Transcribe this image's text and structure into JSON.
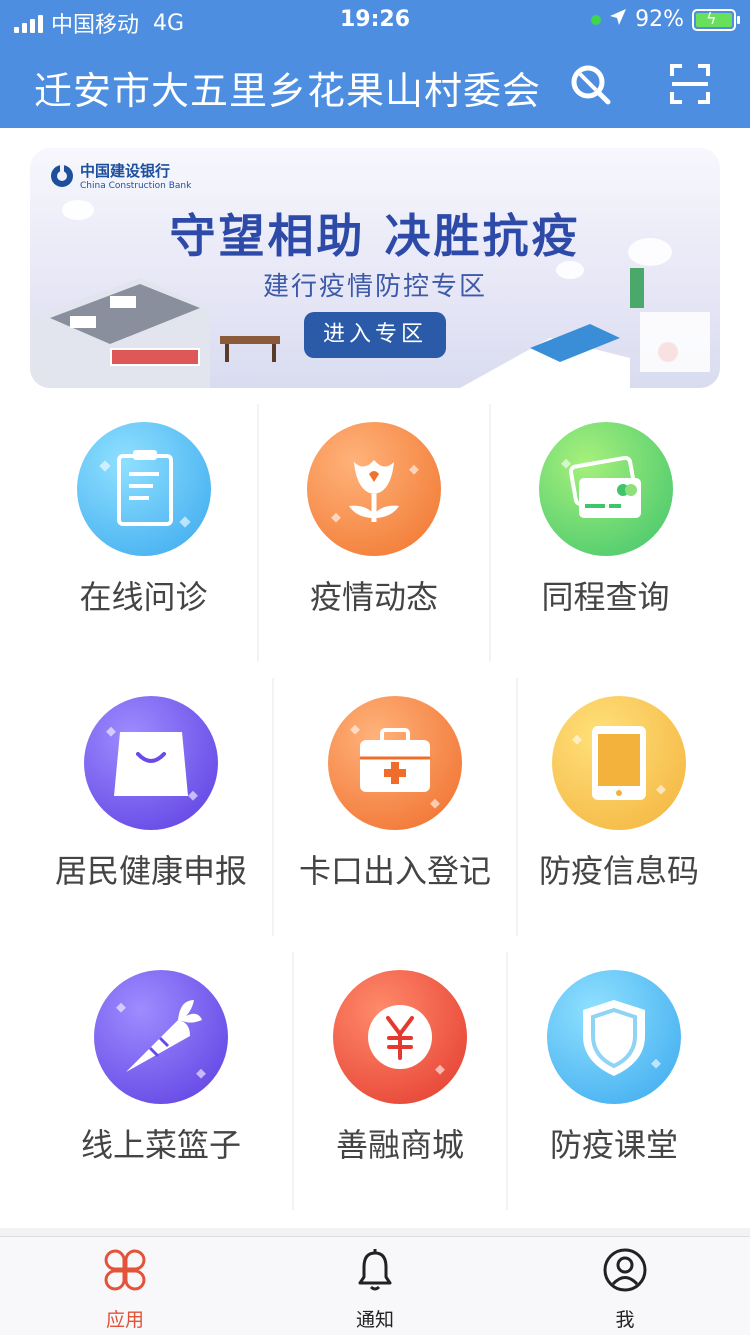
{
  "status_bar": {
    "carrier": "中国移动",
    "network": "4G",
    "time": "19:26",
    "battery": "92%"
  },
  "header": {
    "title": "迁安市大五里乡花果山村委会"
  },
  "banner": {
    "bank_name": "中国建设银行",
    "bank_name_en": "China Construction Bank",
    "headline": "守望相助  决胜抗疫",
    "subtitle": "建行疫情防控专区",
    "button": "进入专区"
  },
  "grid": {
    "row1": [
      {
        "label": "在线问诊",
        "icon": "clipboard-icon"
      },
      {
        "label": "疫情动态",
        "icon": "flower-icon"
      },
      {
        "label": "同程查询",
        "icon": "cards-icon"
      }
    ],
    "row2": [
      {
        "label": "居民健康申报",
        "icon": "bag-icon"
      },
      {
        "label": "卡口出入登记",
        "icon": "medkit-icon"
      },
      {
        "label": "防疫信息码",
        "icon": "tablet-icon"
      }
    ],
    "row3": [
      {
        "label": "线上菜篮子",
        "icon": "carrot-icon"
      },
      {
        "label": "善融商城",
        "icon": "yuan-icon"
      },
      {
        "label": "防疫课堂",
        "icon": "shield-icon"
      }
    ]
  },
  "tabs": [
    {
      "label": "应用",
      "icon": "apps-icon",
      "active": true
    },
    {
      "label": "通知",
      "icon": "bell-icon",
      "active": false
    },
    {
      "label": "我",
      "icon": "user-icon",
      "active": false
    }
  ],
  "colors": {
    "header": "#4d8ee0",
    "active_tab": "#e2533a"
  }
}
